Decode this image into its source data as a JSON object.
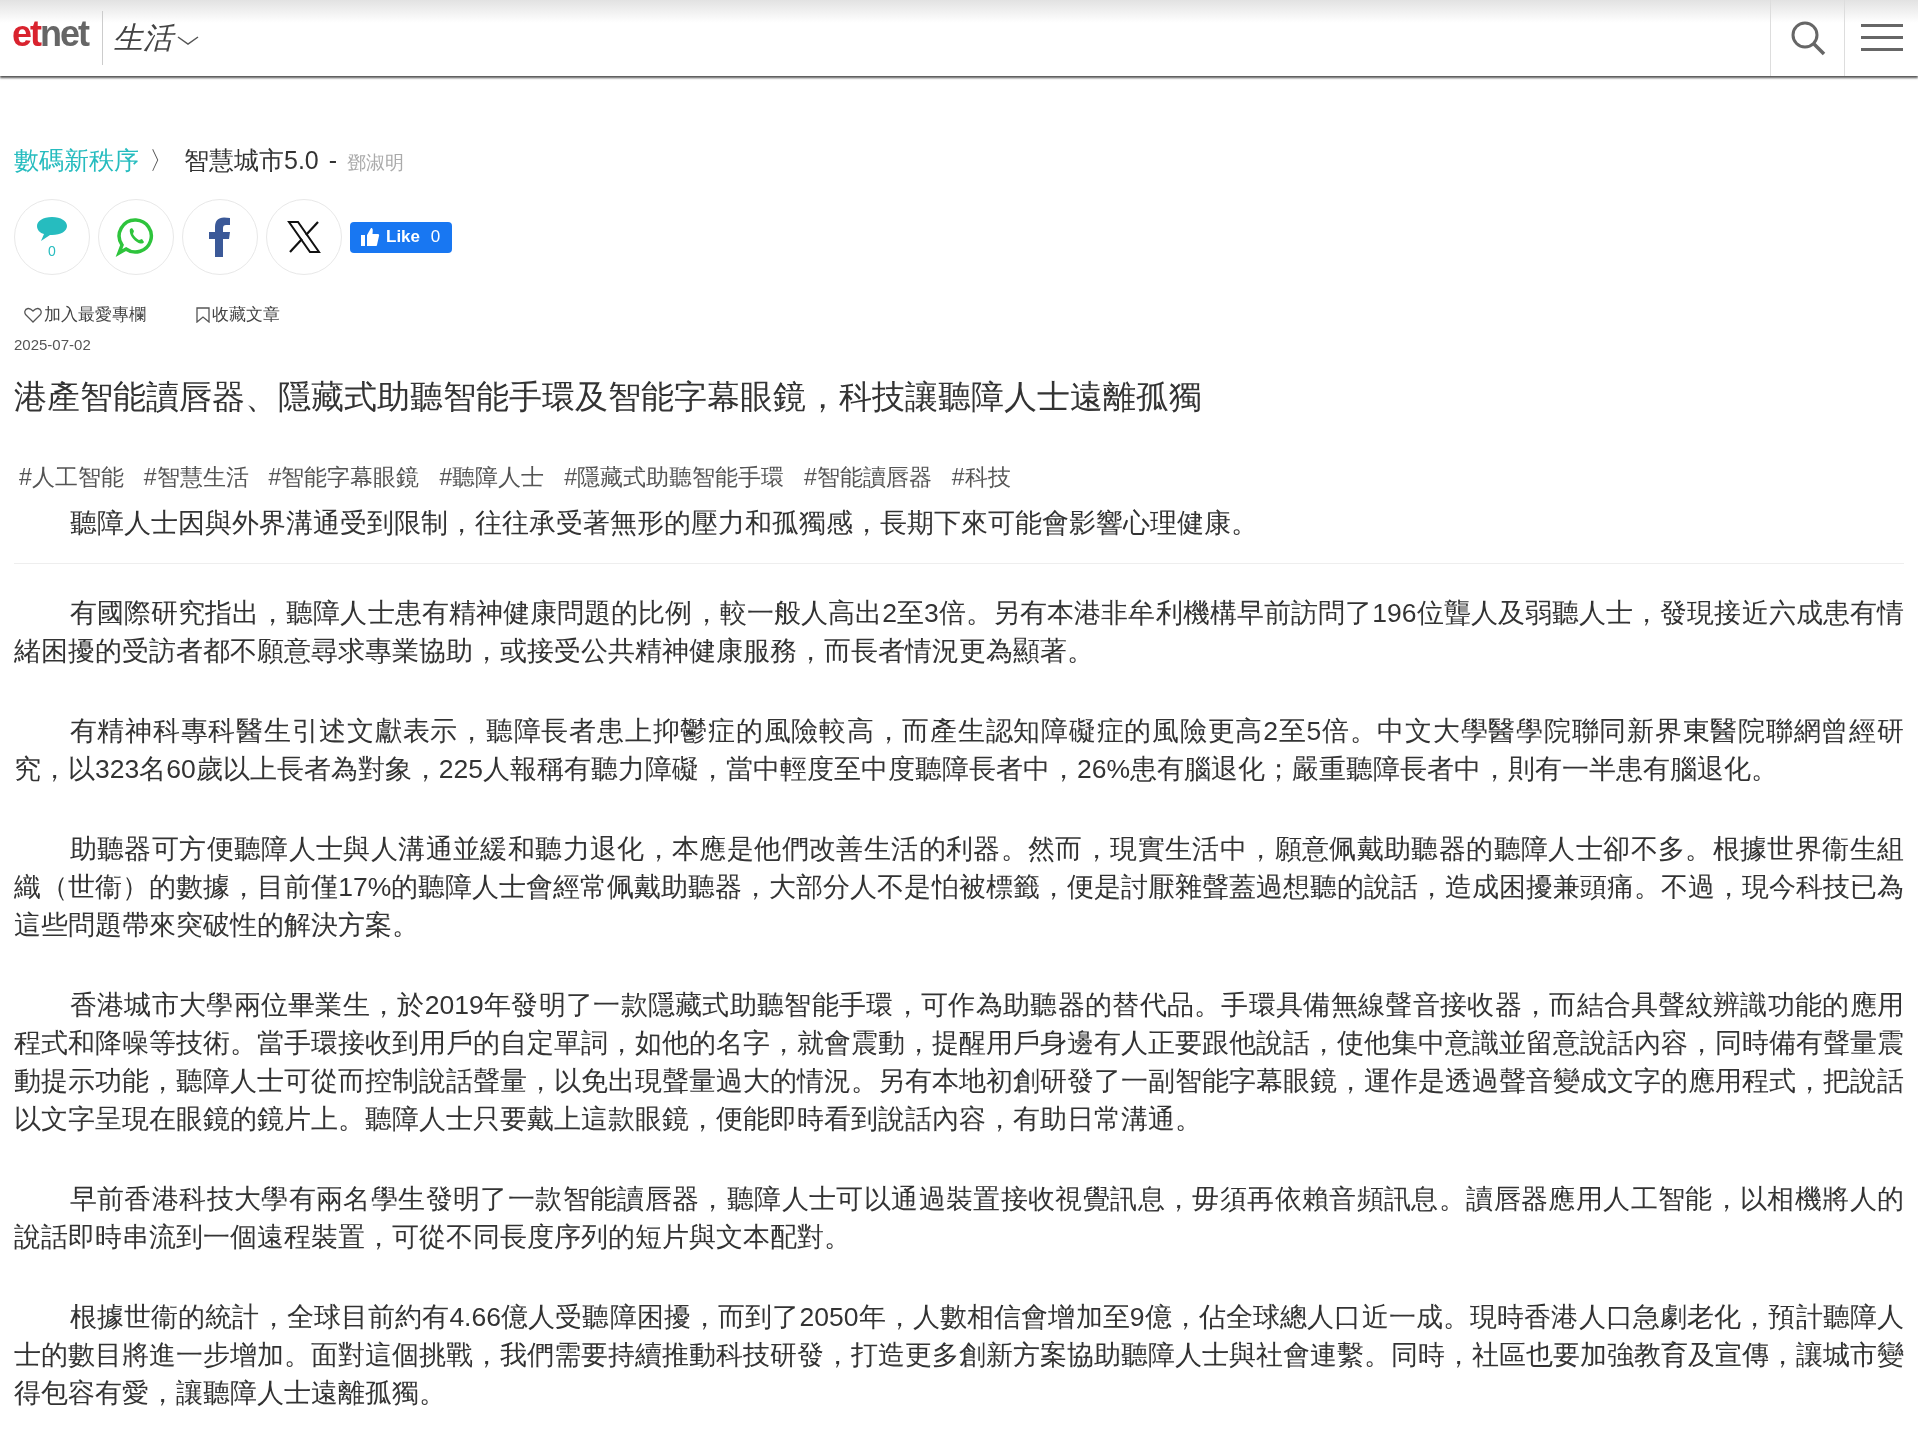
{
  "header": {
    "logo": {
      "part_1": "et",
      "part_2": "net"
    },
    "section": "生活"
  },
  "breadcrumb": {
    "column": "數碼新秩序",
    "separator": "〉",
    "series": "智慧城市5.0",
    "dash": "-",
    "author": "鄧淑明"
  },
  "share": {
    "comment_count": "0",
    "like_label": "Like",
    "like_count": "0"
  },
  "actions": [
    {
      "kind": "heart",
      "label": "加入最愛專欄"
    },
    {
      "kind": "bookmark",
      "label": "收藏文章"
    }
  ],
  "date": "2025-07-02",
  "headline": "港產智能讀唇器、隱藏式助聽智能手環及智能字幕眼鏡，科技讓聽障人士遠離孤獨",
  "tags": [
    "#人工智能",
    "#智慧生活",
    "#智能字幕眼鏡",
    "#聽障人士",
    "#隱藏式助聽智能手環",
    "#智能讀唇器",
    "#科技"
  ],
  "lead": "聽障人士因與外界溝通受到限制，往往承受著無形的壓力和孤獨感，長期下來可能會影響心理健康。",
  "paragraphs": [
    "有國際研究指出，聽障人士患有精神健康問題的比例，較一般人高出2至3倍。另有本港非牟利機構早前訪問了196位聾人及弱聽人士，發現接近六成患有情緒困擾的受訪者都不願意尋求專業協助，或接受公共精神健康服務，而長者情況更為顯著。",
    "有精神科專科醫生引述文獻表示，聽障長者患上抑鬱症的風險較高，而產生認知障礙症的風險更高2至5倍。中文大學醫學院聯同新界東醫院聯網曾經研究，以323名60歲以上長者為對象，225人報稱有聽力障礙，當中輕度至中度聽障長者中，26%患有腦退化；嚴重聽障長者中，則有一半患有腦退化。",
    "助聽器可方便聽障人士與人溝通並緩和聽力退化，本應是他們改善生活的利器。然而，現實生活中，願意佩戴助聽器的聽障人士卻不多。根據世界衞生組織（世衞）的數據，目前僅17%的聽障人士會經常佩戴助聽器，大部分人不是怕被標籤，便是討厭雜聲蓋過想聽的說話，造成困擾兼頭痛。不過，現今科技已為這些問題帶來突破性的解決方案。",
    "香港城市大學兩位畢業生，於2019年發明了一款隱藏式助聽智能手環，可作為助聽器的替代品。手環具備無線聲音接收器，而結合具聲紋辨識功能的應用程式和降噪等技術。當手環接收到用戶的自定單詞，如他的名字，就會震動，提醒用戶身邊有人正要跟他說話，使他集中意識並留意說話內容，同時備有聲量震動提示功能，聽障人士可從而控制說話聲量，以免出現聲量過大的情況。另有本地初創研發了一副智能字幕眼鏡，運作是透過聲音變成文字的應用程式，把說話以文字呈現在眼鏡的鏡片上。聽障人士只要戴上這款眼鏡，便能即時看到說話內容，有助日常溝通。",
    "早前香港科技大學有兩名學生發明了一款智能讀唇器，聽障人士可以通過裝置接收視覺訊息，毋須再依賴音頻訊息。讀唇器應用人工智能，以相機將人的說話即時串流到一個遠程裝置，可從不同長度序列的短片與文本配對。",
    "根據世衞的統計，全球目前約有4.66億人受聽障困擾，而到了2050年，人數相信會增加至9億，佔全球總人口近一成。現時香港人口急劇老化，預計聽障人士的數目將進一步增加。面對這個挑戰，我們需要持續推動科技研發，打造更多創新方案協助聽障人士與社會連繫。同時，社區也要加強教育及宣傳，讓城市變得包容有愛，讓聽障人士遠離孤獨。"
  ]
}
